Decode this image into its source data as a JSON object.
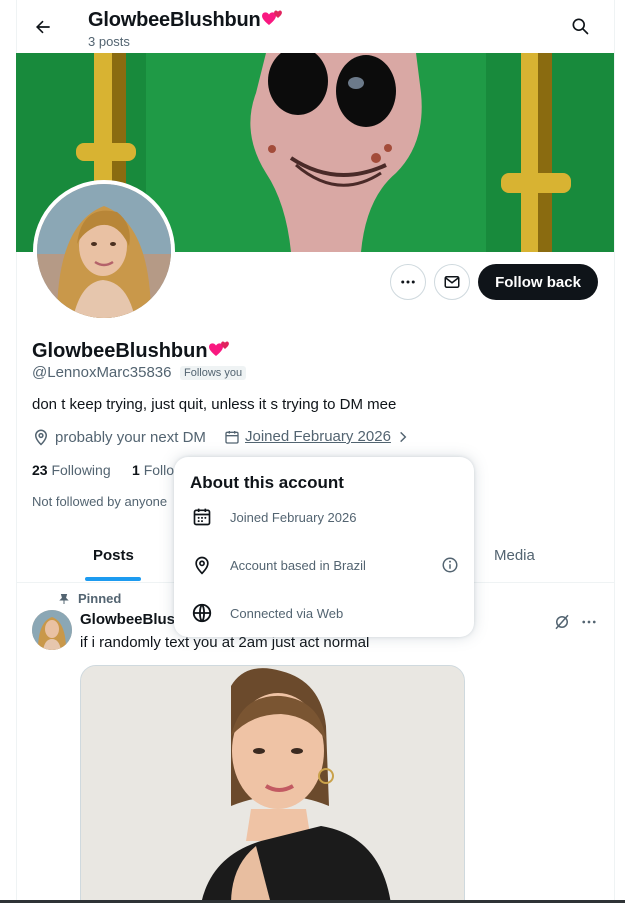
{
  "header": {
    "title": "GlowbeeBlushbun",
    "posts_count": "3 posts"
  },
  "profile": {
    "name": "GlowbeeBlushbun",
    "handle": "@LennoxMarc35836",
    "follows_you": "Follows you",
    "bio": "don t keep trying, just quit, unless it s trying to DM mee",
    "location": "probably your next DM",
    "joined": "Joined February 2026",
    "following_count": "23",
    "following_label": "Following",
    "followers_count": "1",
    "followers_label": "Follo",
    "not_followed": "Not followed by anyone",
    "follow_button": "Follow back"
  },
  "tabs": [
    {
      "label": "Posts",
      "active": true
    },
    {
      "label": "Media",
      "active": false
    }
  ],
  "post": {
    "pinned_label": "Pinned",
    "author": "GlowbeeBlus",
    "text": "if i randomly text you at 2am just act normal"
  },
  "popover": {
    "title": "About this account",
    "rows": [
      {
        "icon": "calendar-icon",
        "label": "Joined February 2026"
      },
      {
        "icon": "location-icon",
        "label": "Account based in Brazil"
      },
      {
        "icon": "globe-icon",
        "label": "Connected via Web"
      }
    ]
  },
  "icons": {
    "back": "arrow-left-icon",
    "search": "search-icon",
    "more": "more-horizontal-icon",
    "message": "envelope-icon",
    "pin": "pin-icon",
    "grok": "grok-icon",
    "info": "info-icon"
  },
  "colors": {
    "primary_text": "#0f1419",
    "secondary_text": "#536471",
    "accent": "#1d9bf0",
    "heart": "#f91880"
  }
}
